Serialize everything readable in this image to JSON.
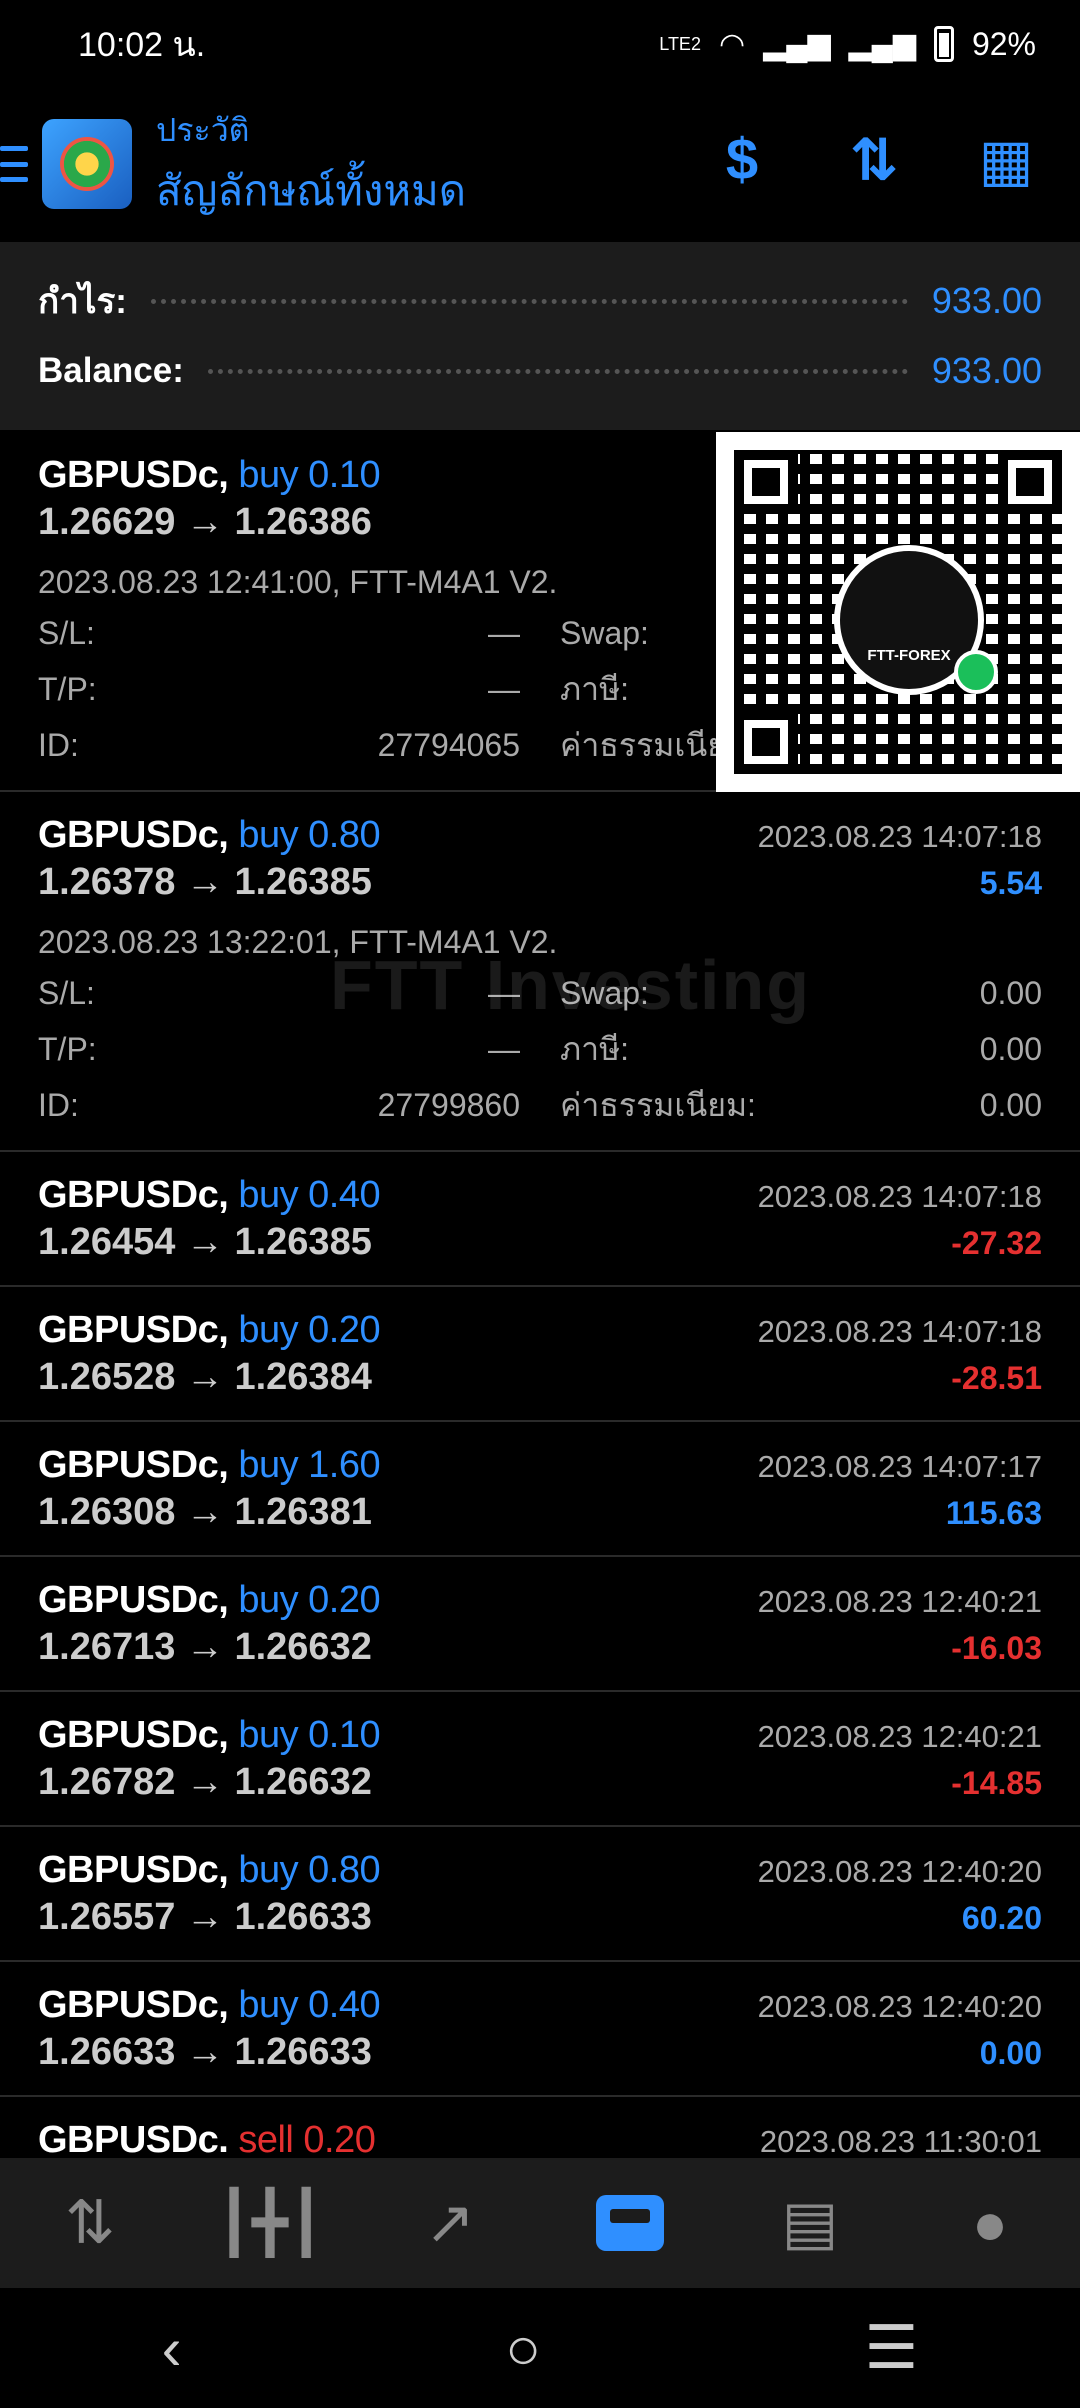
{
  "status_bar": {
    "time": "10:02 น.",
    "network": "LTE2",
    "battery": "92%"
  },
  "header": {
    "subtitle": "ประวัติ",
    "title": "สัญลักษณ์ทั้งหมด"
  },
  "summary": {
    "profit_label": "กำไร:",
    "profit_value": "933.00",
    "balance_label": "Balance:",
    "balance_value": "933.00"
  },
  "labels": {
    "sl": "S/L:",
    "tp": "T/P:",
    "id": "ID:",
    "swap": "Swap:",
    "tax": "ภาษี:",
    "commission": "ค่าธรรมเนียม:"
  },
  "deals": [
    {
      "symbol": "GBPUSDc,",
      "type": "buy 0.10",
      "prices": "1.26629 → 1.26386",
      "time": "",
      "profit": "",
      "info": "2023.08.23 12:41:00, FTT-M4A1 V2.",
      "sl": "—",
      "tp": "—",
      "id": "27794065",
      "swap": "",
      "tax": "",
      "commission": ""
    },
    {
      "symbol": "GBPUSDc,",
      "type": "buy 0.80",
      "prices": "1.26378 → 1.26385",
      "time": "2023.08.23 14:07:18",
      "profit": "5.54",
      "info": "2023.08.23 13:22:01, FTT-M4A1 V2.",
      "sl": "—",
      "tp": "—",
      "id": "27799860",
      "swap": "0.00",
      "tax": "0.00",
      "commission": "0.00"
    },
    {
      "symbol": "GBPUSDc,",
      "type": "buy 0.40",
      "prices": "1.26454 → 1.26385",
      "time": "2023.08.23 14:07:18",
      "profit": "-27.32"
    },
    {
      "symbol": "GBPUSDc,",
      "type": "buy 0.20",
      "prices": "1.26528 → 1.26384",
      "time": "2023.08.23 14:07:18",
      "profit": "-28.51"
    },
    {
      "symbol": "GBPUSDc,",
      "type": "buy 1.60",
      "prices": "1.26308 → 1.26381",
      "time": "2023.08.23 14:07:17",
      "profit": "115.63"
    },
    {
      "symbol": "GBPUSDc,",
      "type": "buy 0.20",
      "prices": "1.26713 → 1.26632",
      "time": "2023.08.23 12:40:21",
      "profit": "-16.03"
    },
    {
      "symbol": "GBPUSDc,",
      "type": "buy 0.10",
      "prices": "1.26782 → 1.26632",
      "time": "2023.08.23 12:40:21",
      "profit": "-14.85"
    },
    {
      "symbol": "GBPUSDc,",
      "type": "buy 0.80",
      "prices": "1.26557 → 1.26633",
      "time": "2023.08.23 12:40:20",
      "profit": "60.20"
    },
    {
      "symbol": "GBPUSDc,",
      "type": "buy 0.40",
      "prices": "1.26633 → 1.26633",
      "time": "2023.08.23 12:40:20",
      "profit": "0.00"
    },
    {
      "symbol": "GBPUSDc.",
      "type": "sell 0.20",
      "prices": "",
      "time": "2023.08.23 11:30:01",
      "profit": ""
    }
  ],
  "overlay": {
    "qr_logo_text": "FTT-FOREX",
    "watermark": "FTT Investing"
  },
  "bottom_nav": [
    "quotes-icon",
    "chart-icon",
    "trade-icon",
    "history-icon",
    "news-icon",
    "chat-icon"
  ],
  "colors": {
    "accent": "#2f8fff",
    "negative": "#e53030",
    "background": "#000000",
    "panel": "#1c1c1c"
  }
}
